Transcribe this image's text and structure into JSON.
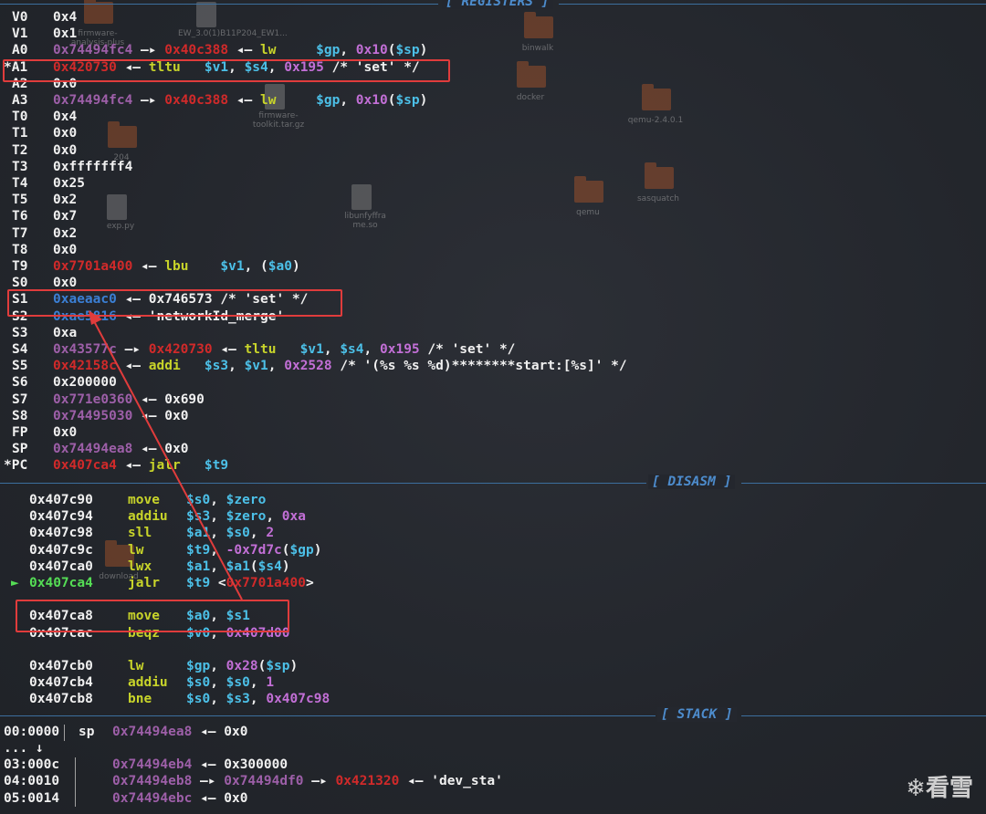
{
  "sections": {
    "registers": "[ REGISTERS ]",
    "disasm": "[ DISASM ]",
    "stack": "[ STACK ]"
  },
  "registers": [
    {
      "name": "V0",
      "parts": [
        {
          "t": "0x4",
          "c": "w"
        }
      ]
    },
    {
      "name": "V1",
      "parts": [
        {
          "t": "0x1",
          "c": "w"
        }
      ]
    },
    {
      "name": "A0",
      "parts": [
        {
          "t": "0x74494fc4",
          "c": "purple"
        },
        {
          "t": " —▸ ",
          "c": "w"
        },
        {
          "t": "0x40c388",
          "c": "red"
        },
        {
          "t": " ◂— ",
          "c": "w"
        },
        {
          "t": "lw",
          "c": "yellow"
        },
        {
          "t": "     ",
          "c": "w"
        },
        {
          "t": "$gp",
          "c": "cyan"
        },
        {
          "t": ", ",
          "c": "w"
        },
        {
          "t": "0x10",
          "c": "magenta"
        },
        {
          "t": "(",
          "c": "w"
        },
        {
          "t": "$sp",
          "c": "cyan"
        },
        {
          "t": ")",
          "c": "w"
        }
      ]
    },
    {
      "name": "*A1",
      "parts": [
        {
          "t": "0x420730",
          "c": "red"
        },
        {
          "t": " ◂— ",
          "c": "w"
        },
        {
          "t": "tltu",
          "c": "yellow"
        },
        {
          "t": "   ",
          "c": "w"
        },
        {
          "t": "$v1",
          "c": "cyan"
        },
        {
          "t": ", ",
          "c": "w"
        },
        {
          "t": "$s4",
          "c": "cyan"
        },
        {
          "t": ", ",
          "c": "w"
        },
        {
          "t": "0x195",
          "c": "magenta"
        },
        {
          "t": " /* 'set' */",
          "c": "w"
        }
      ]
    },
    {
      "name": "A2",
      "parts": [
        {
          "t": "0x0",
          "c": "w"
        }
      ]
    },
    {
      "name": "A3",
      "parts": [
        {
          "t": "0x74494fc4",
          "c": "purple"
        },
        {
          "t": " —▸ ",
          "c": "w"
        },
        {
          "t": "0x40c388",
          "c": "red"
        },
        {
          "t": " ◂— ",
          "c": "w"
        },
        {
          "t": "lw",
          "c": "yellow"
        },
        {
          "t": "     ",
          "c": "w"
        },
        {
          "t": "$gp",
          "c": "cyan"
        },
        {
          "t": ", ",
          "c": "w"
        },
        {
          "t": "0x10",
          "c": "magenta"
        },
        {
          "t": "(",
          "c": "w"
        },
        {
          "t": "$sp",
          "c": "cyan"
        },
        {
          "t": ")",
          "c": "w"
        }
      ]
    },
    {
      "name": "T0",
      "parts": [
        {
          "t": "0x4",
          "c": "w"
        }
      ]
    },
    {
      "name": "T1",
      "parts": [
        {
          "t": "0x0",
          "c": "w"
        }
      ]
    },
    {
      "name": "T2",
      "parts": [
        {
          "t": "0x0",
          "c": "w"
        }
      ]
    },
    {
      "name": "T3",
      "parts": [
        {
          "t": "0xfffffff4",
          "c": "w"
        }
      ]
    },
    {
      "name": "T4",
      "parts": [
        {
          "t": "0x25",
          "c": "w"
        }
      ]
    },
    {
      "name": "T5",
      "parts": [
        {
          "t": "0x2",
          "c": "w"
        }
      ]
    },
    {
      "name": "T6",
      "parts": [
        {
          "t": "0x7",
          "c": "w"
        }
      ]
    },
    {
      "name": "T7",
      "parts": [
        {
          "t": "0x2",
          "c": "w"
        }
      ]
    },
    {
      "name": "T8",
      "parts": [
        {
          "t": "0x0",
          "c": "w"
        }
      ]
    },
    {
      "name": "T9",
      "parts": [
        {
          "t": "0x7701a400",
          "c": "red"
        },
        {
          "t": " ◂— ",
          "c": "w"
        },
        {
          "t": "lbu",
          "c": "yellow"
        },
        {
          "t": "    ",
          "c": "w"
        },
        {
          "t": "$v1",
          "c": "cyan"
        },
        {
          "t": ", (",
          "c": "w"
        },
        {
          "t": "$a0",
          "c": "cyan"
        },
        {
          "t": ")",
          "c": "w"
        }
      ]
    },
    {
      "name": "S0",
      "parts": [
        {
          "t": "0x0",
          "c": "w"
        }
      ]
    },
    {
      "name": "S1",
      "parts": [
        {
          "t": "0xaeaac0",
          "c": "blue"
        },
        {
          "t": " ◂— 0x746573 /* 'set' */",
          "c": "w"
        }
      ]
    },
    {
      "name": "S2",
      "parts": [
        {
          "t": "0xae5816",
          "c": "blue"
        },
        {
          "t": " ◂— 'networkId_merge'",
          "c": "w"
        }
      ]
    },
    {
      "name": "S3",
      "parts": [
        {
          "t": "0xa",
          "c": "w"
        }
      ]
    },
    {
      "name": "S4",
      "parts": [
        {
          "t": "0x43577c",
          "c": "purple"
        },
        {
          "t": " —▸ ",
          "c": "w"
        },
        {
          "t": "0x420730",
          "c": "red"
        },
        {
          "t": " ◂— ",
          "c": "w"
        },
        {
          "t": "tltu",
          "c": "yellow"
        },
        {
          "t": "   ",
          "c": "w"
        },
        {
          "t": "$v1",
          "c": "cyan"
        },
        {
          "t": ", ",
          "c": "w"
        },
        {
          "t": "$s4",
          "c": "cyan"
        },
        {
          "t": ", ",
          "c": "w"
        },
        {
          "t": "0x195",
          "c": "magenta"
        },
        {
          "t": " /* 'set' */",
          "c": "w"
        }
      ]
    },
    {
      "name": "S5",
      "parts": [
        {
          "t": "0x42158c",
          "c": "red"
        },
        {
          "t": " ◂— ",
          "c": "w"
        },
        {
          "t": "addi",
          "c": "yellow"
        },
        {
          "t": "   ",
          "c": "w"
        },
        {
          "t": "$s3",
          "c": "cyan"
        },
        {
          "t": ", ",
          "c": "w"
        },
        {
          "t": "$v1",
          "c": "cyan"
        },
        {
          "t": ", ",
          "c": "w"
        },
        {
          "t": "0x2528",
          "c": "magenta"
        },
        {
          "t": " /* '(%s %s %d)********start:[%s]' */",
          "c": "w"
        }
      ]
    },
    {
      "name": "S6",
      "parts": [
        {
          "t": "0x200000",
          "c": "w"
        }
      ]
    },
    {
      "name": "S7",
      "parts": [
        {
          "t": "0x771e0360",
          "c": "purple"
        },
        {
          "t": " ◂— 0x690",
          "c": "w"
        }
      ]
    },
    {
      "name": "S8",
      "parts": [
        {
          "t": "0x74495030",
          "c": "purple"
        },
        {
          "t": " ◂— 0x0",
          "c": "w"
        }
      ]
    },
    {
      "name": "FP",
      "parts": [
        {
          "t": "0x0",
          "c": "w"
        }
      ]
    },
    {
      "name": "SP",
      "parts": [
        {
          "t": "0x74494ea8",
          "c": "purple"
        },
        {
          "t": " ◂— 0x0",
          "c": "w"
        }
      ]
    },
    {
      "name": "*PC",
      "parts": [
        {
          "t": "0x407ca4",
          "c": "red"
        },
        {
          "t": " ◂— ",
          "c": "w"
        },
        {
          "t": "jalr",
          "c": "yellow"
        },
        {
          "t": "   ",
          "c": "w"
        },
        {
          "t": "$t9",
          "c": "cyan"
        }
      ]
    }
  ],
  "disasm": [
    {
      "marker": "",
      "addr": "0x407c90",
      "op": "move",
      "ops": [
        {
          "t": "$s0",
          "c": "cyan"
        },
        {
          "t": ", ",
          "c": "w"
        },
        {
          "t": "$zero",
          "c": "cyan"
        }
      ]
    },
    {
      "marker": "",
      "addr": "0x407c94",
      "op": "addiu",
      "ops": [
        {
          "t": "$s3",
          "c": "cyan"
        },
        {
          "t": ", ",
          "c": "w"
        },
        {
          "t": "$zero",
          "c": "cyan"
        },
        {
          "t": ", ",
          "c": "w"
        },
        {
          "t": "0xa",
          "c": "magenta"
        }
      ]
    },
    {
      "marker": "",
      "addr": "0x407c98",
      "op": "sll",
      "ops": [
        {
          "t": "$a1",
          "c": "cyan"
        },
        {
          "t": ", ",
          "c": "w"
        },
        {
          "t": "$s0",
          "c": "cyan"
        },
        {
          "t": ", ",
          "c": "w"
        },
        {
          "t": "2",
          "c": "magenta"
        }
      ]
    },
    {
      "marker": "",
      "addr": "0x407c9c",
      "op": "lw",
      "ops": [
        {
          "t": "$t9",
          "c": "cyan"
        },
        {
          "t": ", ",
          "c": "w"
        },
        {
          "t": "-0x7d7c",
          "c": "magenta"
        },
        {
          "t": "(",
          "c": "w"
        },
        {
          "t": "$gp",
          "c": "cyan"
        },
        {
          "t": ")",
          "c": "w"
        }
      ]
    },
    {
      "marker": "",
      "addr": "0x407ca0",
      "op": "lwx",
      "ops": [
        {
          "t": "$a1",
          "c": "cyan"
        },
        {
          "t": ", ",
          "c": "w"
        },
        {
          "t": "$a1",
          "c": "cyan"
        },
        {
          "t": "(",
          "c": "w"
        },
        {
          "t": "$s4",
          "c": "cyan"
        },
        {
          "t": ")",
          "c": "w"
        }
      ]
    },
    {
      "marker": "►",
      "addr": "0x407ca4",
      "op": "jalr",
      "ops": [
        {
          "t": "$t9",
          "c": "cyan"
        },
        {
          "t": " <",
          "c": "w"
        },
        {
          "t": "0x7701a400",
          "c": "red"
        },
        {
          "t": ">",
          "c": "w"
        }
      ],
      "current": true
    },
    {
      "marker": "",
      "addr": "",
      "op": "",
      "ops": []
    },
    {
      "marker": "",
      "addr": "0x407ca8",
      "op": "move",
      "ops": [
        {
          "t": "$a0",
          "c": "cyan"
        },
        {
          "t": ", ",
          "c": "w"
        },
        {
          "t": "$s1",
          "c": "cyan"
        }
      ]
    },
    {
      "marker": "",
      "addr": "0x407cac",
      "op": "beqz",
      "ops": [
        {
          "t": "$v0",
          "c": "cyan"
        },
        {
          "t": ", ",
          "c": "w"
        },
        {
          "t": "0x407d00",
          "c": "magenta"
        }
      ]
    },
    {
      "marker": "",
      "addr": "",
      "op": "",
      "ops": []
    },
    {
      "marker": "",
      "addr": "0x407cb0",
      "op": "lw",
      "ops": [
        {
          "t": "$gp",
          "c": "cyan"
        },
        {
          "t": ", ",
          "c": "w"
        },
        {
          "t": "0x28",
          "c": "magenta"
        },
        {
          "t": "(",
          "c": "w"
        },
        {
          "t": "$sp",
          "c": "cyan"
        },
        {
          "t": ")",
          "c": "w"
        }
      ]
    },
    {
      "marker": "",
      "addr": "0x407cb4",
      "op": "addiu",
      "ops": [
        {
          "t": "$s0",
          "c": "cyan"
        },
        {
          "t": ", ",
          "c": "w"
        },
        {
          "t": "$s0",
          "c": "cyan"
        },
        {
          "t": ", ",
          "c": "w"
        },
        {
          "t": "1",
          "c": "magenta"
        }
      ]
    },
    {
      "marker": "",
      "addr": "0x407cb8",
      "op": "bne",
      "ops": [
        {
          "t": "$s0",
          "c": "cyan"
        },
        {
          "t": ", ",
          "c": "w"
        },
        {
          "t": "$s3",
          "c": "cyan"
        },
        {
          "t": ", ",
          "c": "w"
        },
        {
          "t": "0x407c98",
          "c": "magenta"
        }
      ]
    }
  ],
  "stack": [
    {
      "off": "00:0000",
      "reg": "sp",
      "parts": [
        {
          "t": "0x74494ea8",
          "c": "purple"
        },
        {
          "t": " ◂— 0x0",
          "c": "w"
        }
      ]
    },
    {
      "off": "... ↓",
      "reg": "",
      "parts": []
    },
    {
      "off": "03:000c",
      "reg": "",
      "parts": [
        {
          "t": "0x74494eb4",
          "c": "purple"
        },
        {
          "t": " ◂— 0x300000",
          "c": "w"
        }
      ]
    },
    {
      "off": "04:0010",
      "reg": "",
      "parts": [
        {
          "t": "0x74494eb8",
          "c": "purple"
        },
        {
          "t": " —▸ ",
          "c": "w"
        },
        {
          "t": "0x74494df0",
          "c": "purple"
        },
        {
          "t": " —▸ ",
          "c": "w"
        },
        {
          "t": "0x421320",
          "c": "red"
        },
        {
          "t": " ◂— 'dev_sta'",
          "c": "w"
        }
      ]
    },
    {
      "off": "05:0014",
      "reg": "",
      "parts": [
        {
          "t": "0x74494ebc",
          "c": "purple"
        },
        {
          "t": " ◂— 0x0",
          "c": "w"
        }
      ]
    }
  ],
  "desktop_icons": [
    {
      "label": "firmware-analysis-plus"
    },
    {
      "label": "EW_3.0(1)B11P204_EW1..."
    },
    {
      "label": "binwalk"
    },
    {
      "label": "docker"
    },
    {
      "label": "qemu-2.4.0.1"
    },
    {
      "label": "firmware-toolkit.tar.gz"
    },
    {
      "label": "204"
    },
    {
      "label": "libunfyffra me.so"
    },
    {
      "label": "sasquatch"
    },
    {
      "label": "qemu"
    },
    {
      "label": "exp.py"
    },
    {
      "label": "download"
    }
  ],
  "watermark": "看雪"
}
